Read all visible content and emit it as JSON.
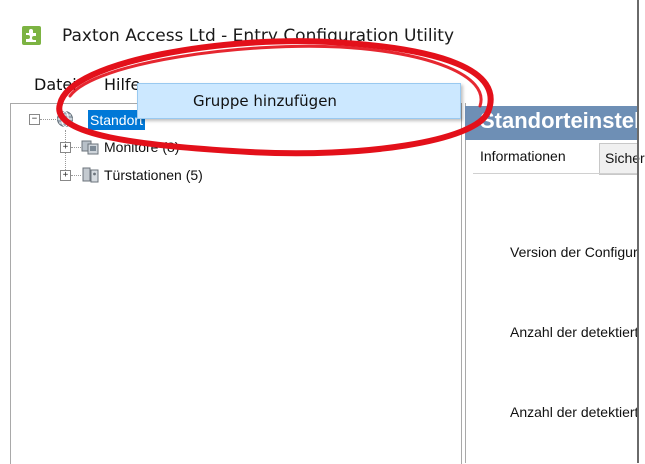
{
  "window": {
    "title": "Paxton Access Ltd - Entry Configuration Utility",
    "icon": "puzzle-app-icon"
  },
  "menu": {
    "file": "Datei",
    "help": "Hilfe"
  },
  "context_menu": {
    "item": "Gruppe hinzufügen"
  },
  "tree": {
    "root": {
      "label": "Standort",
      "icon": "globe-icon"
    },
    "children": [
      {
        "label": "Monitore (8)",
        "icon": "monitor-icon"
      },
      {
        "label": "Türstationen (5)",
        "icon": "door-station-icon"
      }
    ]
  },
  "detail": {
    "header": "Standorteinstellungen",
    "tabs": [
      "Informationen",
      "Sicherheit"
    ],
    "rows": [
      "Version der Configuration Utility",
      "Anzahl der detektierten Monitore",
      "Anzahl der detektierten Türstationen"
    ]
  },
  "annotation": {
    "shape": "red-ellipse",
    "color": "#e3101a"
  },
  "colors": {
    "selection": "#0078d7",
    "header": "#6e8fb5",
    "context_highlight": "#cce8ff"
  }
}
